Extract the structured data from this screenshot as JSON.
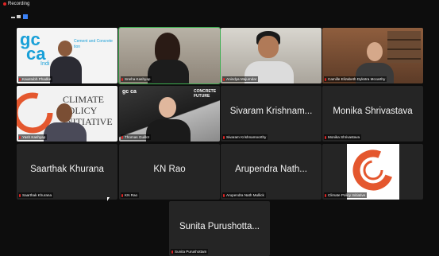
{
  "recording": {
    "label": "Recording"
  },
  "participants": [
    {
      "name": "Kaustubh Phadke",
      "big_name": "",
      "speaking": false,
      "logo_text_1": "gc",
      "logo_text_2": "ca",
      "logo_subtext": "Cement and Concrete",
      "logo_subtext_2": "tion",
      "logo_bottom": "Indi"
    },
    {
      "name": "Sneha Kashyap",
      "big_name": "",
      "speaking": true
    },
    {
      "name": "Anindya Majumdar",
      "big_name": "",
      "speaking": false
    },
    {
      "name": "Camille Elizabeth Dykstra Mccarthy",
      "big_name": "",
      "speaking": false
    },
    {
      "name": "Yash Kashyap",
      "big_name": "",
      "speaking": false,
      "bg_text": "CLIMATE POLICY INITIATIVE",
      "bg_line1": "CLIMATE",
      "bg_line2": "POLICY",
      "bg_line3": "INITIATIVE"
    },
    {
      "name": "Thomas Guillot",
      "big_name": "",
      "speaking": false,
      "bg_logo": "gc ca",
      "bg_word": "CONCRETE FUTURE",
      "bg_word1": "CONCRETE",
      "bg_word2": "FUTURE"
    },
    {
      "name": "Sivaram Krishnamoorthy",
      "big_name": "Sivaram Krishnam...",
      "speaking": false
    },
    {
      "name": "Monika Shrivastava",
      "big_name": "Monika Shrivastava",
      "speaking": false
    },
    {
      "name": "Saarthak Khurana",
      "big_name": "Saarthak Khurana",
      "speaking": false
    },
    {
      "name": "KN Rao",
      "big_name": "KN Rao",
      "speaking": false
    },
    {
      "name": "Arupendra Nath Mullick",
      "big_name": "Arupendra Nath...",
      "speaking": false
    },
    {
      "name": "Climate Policy Initiative",
      "big_name": "",
      "speaking": false
    },
    {
      "name": "Sunita Purushottam",
      "big_name": "Sunita Purushotta...",
      "speaking": false
    }
  ],
  "colors": {
    "background": "#0d0d0d",
    "tile": "#252525",
    "speaking_border": "#3fae52",
    "mic_muted": "#e02424",
    "cpi_orange": "#e4572e"
  },
  "icons": {
    "view": "gallery-view-icon",
    "mic": "mic-muted-icon"
  }
}
